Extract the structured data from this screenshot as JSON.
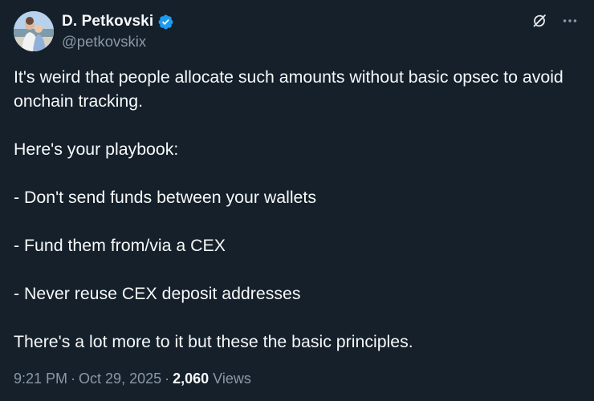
{
  "author": {
    "display_name": "D. Petkovski",
    "handle": "@petkovskix",
    "verified": true,
    "avatar_icon": "profile-photo"
  },
  "actions": {
    "grok_icon": "grok-icon",
    "more_icon": "more-options-icon"
  },
  "tweet": {
    "paragraphs": [
      "It's weird that people allocate such amounts without basic opsec to avoid onchain tracking.",
      "Here's your playbook:",
      "- Don't send funds between your wallets",
      "- Fund them from/via a CEX",
      "- Never reuse CEX deposit addresses",
      "There's a lot more to it but these the basic principles."
    ]
  },
  "meta": {
    "time": "9:21 PM",
    "separator": "·",
    "date": "Oct 29, 2025",
    "views_count": "2,060",
    "views_label": "Views"
  },
  "colors": {
    "background": "#15202b",
    "text_primary": "#f7f9f9",
    "text_secondary": "#8b98a5",
    "verified_badge": "#1d9bf0"
  }
}
